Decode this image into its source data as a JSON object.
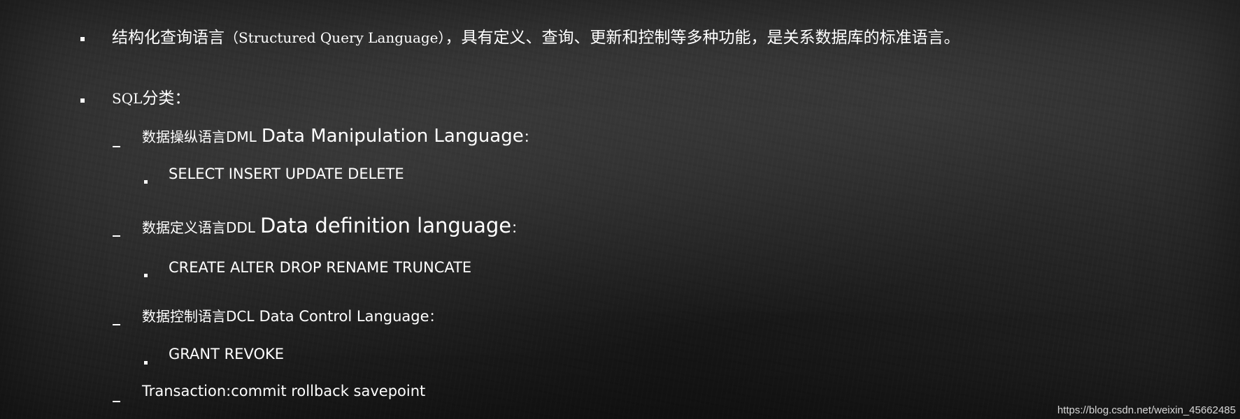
{
  "lines": {
    "intro": {
      "prefix": "结构化查询语言",
      "paren": "（Structured Query Language）",
      "suffix": "，具有定义、查询、更新和控制等多种功能，是关系数据库的标准语言。"
    },
    "sql_category": {
      "sql": "SQL",
      "text": "分类："
    },
    "dml": {
      "cn": "数据操纵语言DML",
      "en": "Data Manipulation Language",
      "colon": "："
    },
    "dml_items": "SELECT INSERT UPDATE DELETE",
    "ddl": {
      "cn": "数据定义语言DDL",
      "en": "Data definition language",
      "colon": "："
    },
    "ddl_items": "CREATE ALTER DROP RENAME TRUNCATE",
    "dcl": {
      "cn": "数据控制语言DCL",
      "en": "Data Control Language",
      "colon": "："
    },
    "dcl_items": "GRANT REVOKE",
    "transaction": "Transaction:commit rollback savepoint"
  },
  "watermark": "https://blog.csdn.net/weixin_45662485",
  "colors": {
    "text": "#ffffff",
    "background": "#2a2a2a"
  }
}
